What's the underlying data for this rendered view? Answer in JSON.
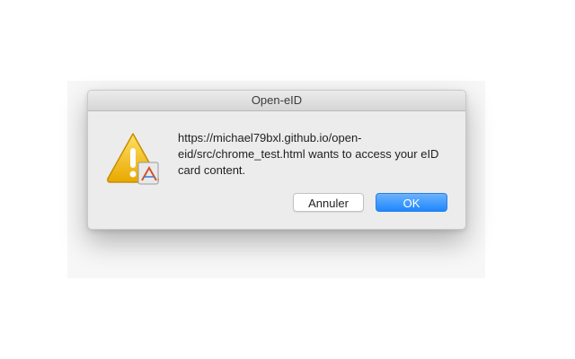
{
  "dialog": {
    "title": "Open-eID",
    "message": "https://michael79bxl.github.io/open-eid/src/chrome_test.html wants to access your eID card content.",
    "icon": "warning-icon",
    "cancel_label": "Annuler",
    "ok_label": "OK"
  },
  "colors": {
    "ok_button": "#1f86fe",
    "warning_triangle": "#f2c200"
  }
}
